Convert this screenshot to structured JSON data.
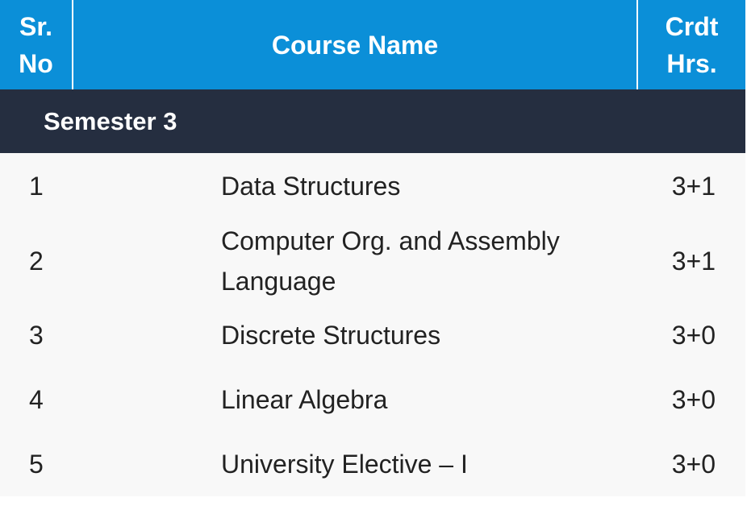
{
  "header": {
    "sr_line1": "Sr.",
    "sr_line2": "No",
    "course_name": "Course Name",
    "crdt_line1": "Crdt",
    "crdt_line2": "Hrs."
  },
  "section": {
    "title": "Semester 3"
  },
  "rows": [
    {
      "sr": "1",
      "name": "Data Structures",
      "credit": "3+1"
    },
    {
      "sr": "2",
      "name": "Computer Org. and Assembly Language",
      "credit": "3+1"
    },
    {
      "sr": "3",
      "name": "Discrete Structures",
      "credit": "3+0"
    },
    {
      "sr": "4",
      "name": "Linear Algebra",
      "credit": "3+0"
    },
    {
      "sr": "5",
      "name": "University Elective – I",
      "credit": "3+0"
    }
  ],
  "colors": {
    "header_bg": "#0b8fd8",
    "section_bg": "#252e40",
    "row_bg": "#f8f8f8"
  }
}
